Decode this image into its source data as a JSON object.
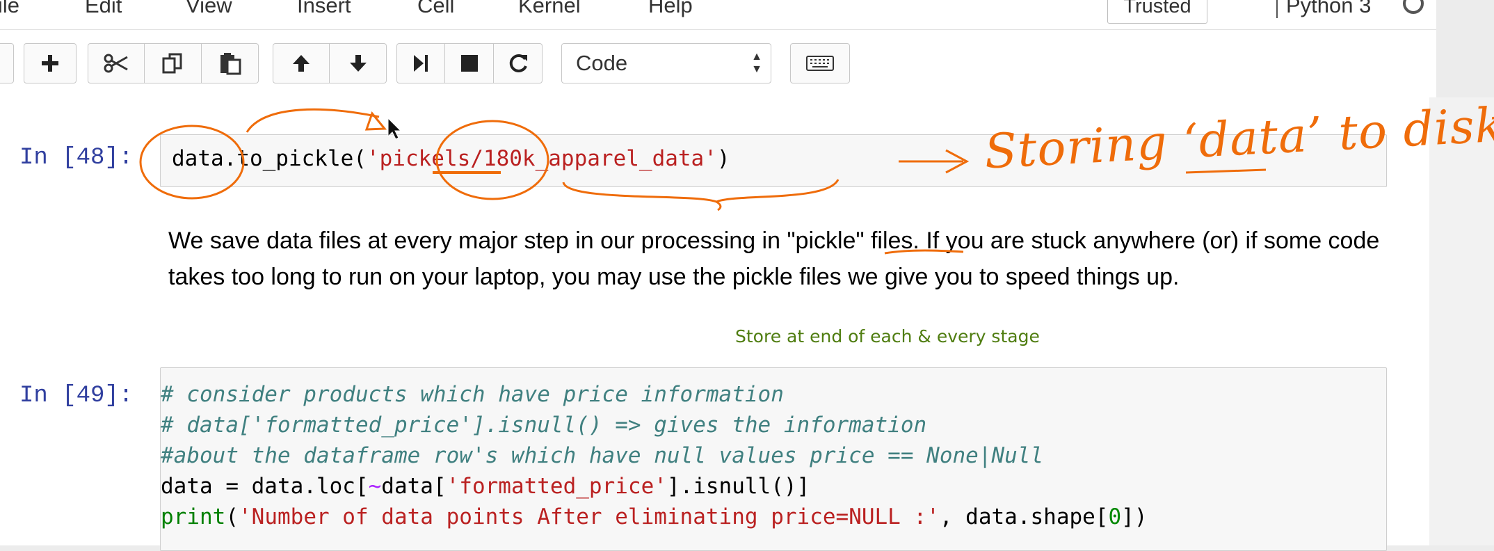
{
  "menu": [
    "File",
    "Edit",
    "View",
    "Insert",
    "Cell",
    "Kernel",
    "Help"
  ],
  "trusted": "Trusted",
  "kernel_name": "Python 3",
  "toolbar": {
    "cell_type": "Code"
  },
  "cells": {
    "first": {
      "prompt": "In [48]:",
      "code_parts": [
        "data",
        ".to_pickle(",
        "'pickels/180k_apparel_data'",
        ")"
      ]
    },
    "markdown": {
      "text": "We save data files at every major step in our processing in \"pickle\" files. If you are stuck anywhere (or) if some code takes too long to run on your laptop, you may use the pickle files we give you to speed things up."
    },
    "note": "Store at end of each & every stage",
    "second": {
      "prompt": "In [49]:",
      "comment1": "# consider products which have price information",
      "comment2": "# data['formatted_price'].isnull() => gives the information",
      "comment3": "#about the dataframe row's which have null values price == None|Null",
      "line4": [
        "data = data.loc[",
        "~",
        "data[",
        "'formatted_price'",
        "].isnull()]"
      ],
      "line5": [
        "print",
        "(",
        "'Number of data points After eliminating price=NULL :'",
        ", data.shape[",
        "0",
        "])"
      ]
    }
  },
  "annotation": {
    "text": "Storing ‘data’ to disk",
    "color": "#ef6c0a"
  }
}
